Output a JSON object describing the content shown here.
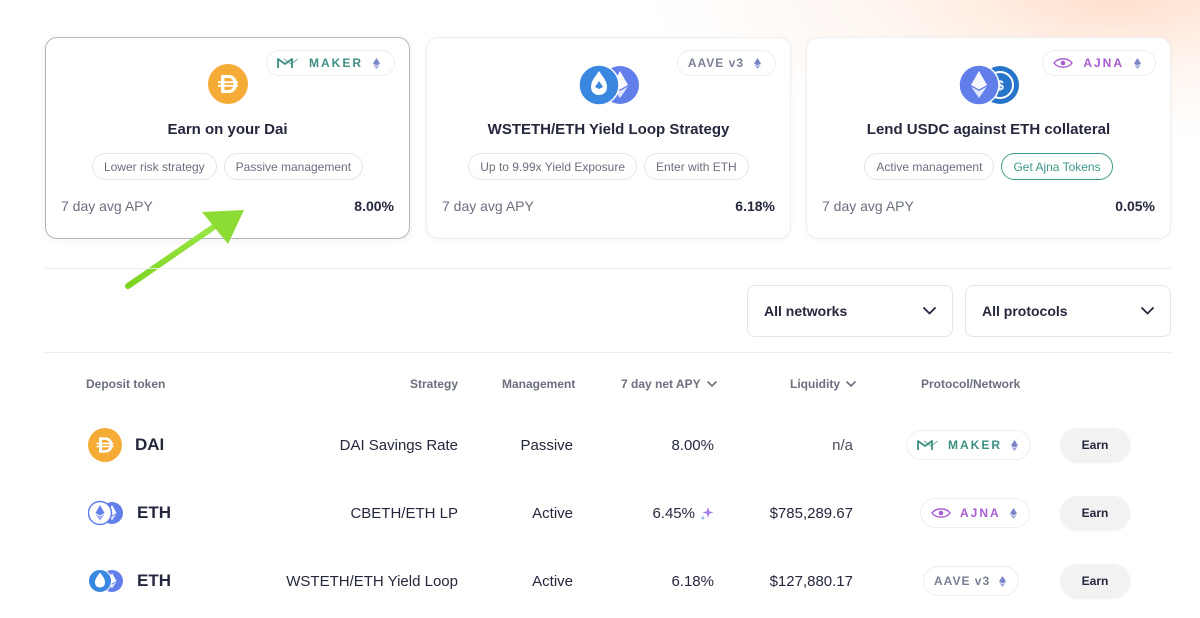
{
  "cards": [
    {
      "protocol": "MAKER",
      "title": "Earn on your Dai",
      "tags": [
        "Lower risk strategy",
        "Passive management"
      ],
      "apy_label": "7 day avg APY",
      "apy_value": "8.00%",
      "token_icon": "dai-icon",
      "selected": true
    },
    {
      "protocol": "AAVE v3",
      "title": "WSTETH/ETH Yield Loop Strategy",
      "tags": [
        "Up to 9.99x Yield Exposure",
        "Enter with ETH"
      ],
      "apy_label": "7 day avg APY",
      "apy_value": "6.18%",
      "token_icon": "wsteth-eth-icon",
      "selected": false
    },
    {
      "protocol": "AJNA",
      "title": "Lend USDC against ETH collateral",
      "tags": [
        "Active management",
        "Get Ajna Tokens"
      ],
      "apy_label": "7 day avg APY",
      "apy_value": "0.05%",
      "token_icon": "eth-usdc-icon",
      "selected": false
    }
  ],
  "filters": {
    "networks": "All networks",
    "protocols": "All protocols"
  },
  "table": {
    "columns": [
      "Deposit token",
      "Strategy",
      "Management",
      "7 day net APY",
      "Liquidity",
      "Protocol/Network"
    ],
    "rows": [
      {
        "token": "DAI",
        "strategy": "DAI Savings Rate",
        "management": "Passive",
        "apy": "8.00%",
        "liquidity": "n/a",
        "protocol": "MAKER",
        "action": "Earn"
      },
      {
        "token": "ETH",
        "strategy": "CBETH/ETH LP",
        "management": "Active",
        "apy": "6.45%",
        "liquidity": "$785,289.67",
        "protocol": "AJNA",
        "action": "Earn"
      },
      {
        "token": "ETH",
        "strategy": "WSTETH/ETH Yield Loop",
        "management": "Active",
        "apy": "6.18%",
        "liquidity": "$127,880.17",
        "protocol": "AAVE v3",
        "action": "Earn"
      }
    ]
  },
  "colors": {
    "maker": "#3d8f82",
    "ajna": "#a95bd1",
    "aave": "#7a7f94",
    "dai": "#f5ac37",
    "eth": "#627eea",
    "arrow": "#7ed321",
    "accent_green": "#3d9a8b"
  }
}
